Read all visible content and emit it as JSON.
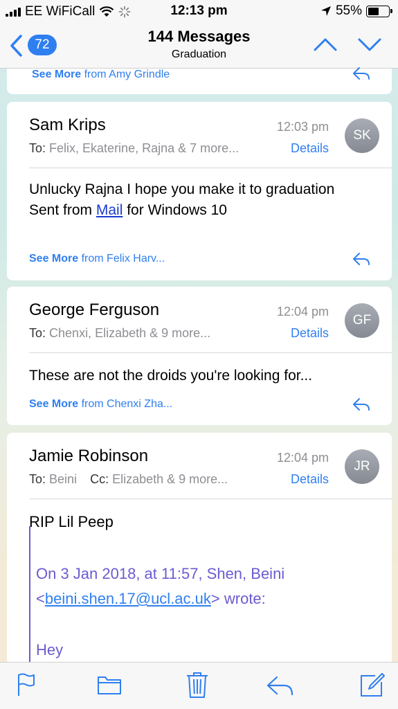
{
  "status_bar": {
    "carrier": "EE WiFiCall",
    "time": "12:13 pm",
    "battery": "55%",
    "battery_level": 0.55
  },
  "nav": {
    "back_count": "72",
    "title": "144 Messages",
    "subtitle": "Graduation"
  },
  "messages": [
    {
      "see_more_label": "See More",
      "see_more_from": "from Amy Grindle"
    },
    {
      "sender": "Sam Krips",
      "time": "12:03 pm",
      "to_label": "To:",
      "recipients": "Felix, Ekaterine, Rajna & 7 more...",
      "details_label": "Details",
      "avatar": "SK",
      "body_line1": "Unlucky Rajna I hope you make it to graduation",
      "body_line2_prefix": "Sent from ",
      "body_line2_link": "Mail",
      "body_line2_suffix": " for Windows 10",
      "see_more_label": "See More",
      "see_more_from": "from Felix Harv..."
    },
    {
      "sender": "George Ferguson",
      "time": "12:04 pm",
      "to_label": "To:",
      "recipients": "Chenxi, Elizabeth & 9 more...",
      "details_label": "Details",
      "avatar": "GF",
      "body_line1": "These are not the droids you're looking for...",
      "see_more_label": "See More",
      "see_more_from": "from Chenxi Zha..."
    },
    {
      "sender": "Jamie Robinson",
      "time": "12:04 pm",
      "to_label": "To:",
      "recipients": "Beini",
      "cc_label": "Cc:",
      "cc_recipients": "Elizabeth & 9 more...",
      "details_label": "Details",
      "avatar": "JR",
      "body_line1": "RIP Lil Peep",
      "quote_line1": "On 3 Jan 2018, at 11:57, Shen, Beini",
      "quote_line2_prefix": "<",
      "quote_line2_link": "beini.shen.17@ucl.ac.uk",
      "quote_line2_suffix": "> wrote:",
      "quote_line3": "Hey"
    }
  ],
  "toolbar": {
    "icons": [
      "flag-icon",
      "folder-icon",
      "trash-icon",
      "reply-icon",
      "compose-icon"
    ]
  },
  "colors": {
    "accent": "#2f7ff0",
    "quote": "#6a5bd0",
    "secondary_text": "#8e8e93"
  }
}
